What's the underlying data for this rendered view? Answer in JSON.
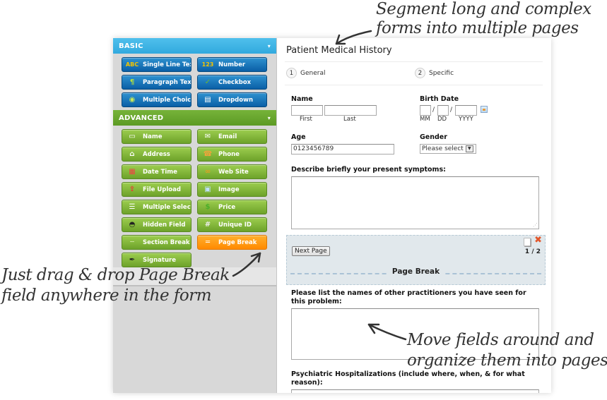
{
  "sidebar": {
    "basic": {
      "title": "BASIC",
      "caret": "▾",
      "items": [
        {
          "label": "Single Line Text",
          "icon": "abc-icon",
          "glyph": "ABC"
        },
        {
          "label": "Number",
          "icon": "number-123-icon",
          "glyph": "123"
        },
        {
          "label": "Paragraph Text",
          "icon": "paragraph-icon",
          "glyph": "¶"
        },
        {
          "label": "Checkbox",
          "icon": "checkbox-icon",
          "glyph": "✓"
        },
        {
          "label": "Multiple Choice",
          "icon": "radio-icon",
          "glyph": "◉"
        },
        {
          "label": "Dropdown",
          "icon": "dropdown-icon",
          "glyph": "▤"
        }
      ]
    },
    "advanced": {
      "title": "ADVANCED",
      "caret": "▾",
      "items": [
        {
          "label": "Name",
          "icon": "id-card-icon",
          "glyph": "▭"
        },
        {
          "label": "Email",
          "icon": "email-icon",
          "glyph": "✉"
        },
        {
          "label": "Address",
          "icon": "home-icon",
          "glyph": "⌂"
        },
        {
          "label": "Phone",
          "icon": "phone-icon",
          "glyph": "☎"
        },
        {
          "label": "Date Time",
          "icon": "calendar-icon",
          "glyph": "▦"
        },
        {
          "label": "Web Site",
          "icon": "link-icon",
          "glyph": "∞"
        },
        {
          "label": "File Upload",
          "icon": "file-upload-icon",
          "glyph": "⇪"
        },
        {
          "label": "Image",
          "icon": "image-icon",
          "glyph": "▣"
        },
        {
          "label": "Multiple Select",
          "icon": "multi-select-icon",
          "glyph": "☰"
        },
        {
          "label": "Price",
          "icon": "dollar-icon",
          "glyph": "$"
        },
        {
          "label": "Hidden Field",
          "icon": "mask-icon",
          "glyph": "◓"
        },
        {
          "label": "Unique ID",
          "icon": "unique-id-icon",
          "glyph": "#"
        },
        {
          "label": "Section Break",
          "icon": "section-break-icon",
          "glyph": "┄"
        },
        {
          "label": "Page Break",
          "icon": "page-break-icon",
          "glyph": "═",
          "highlighted": true
        },
        {
          "label": "Signature",
          "icon": "pen-icon",
          "glyph": "✒"
        }
      ]
    }
  },
  "form": {
    "title": "Patient Medical History",
    "steps": [
      {
        "num": "1",
        "label": "General"
      },
      {
        "num": "2",
        "label": "Specific"
      }
    ],
    "name": {
      "label": "Name",
      "first": "First",
      "last": "Last"
    },
    "birth_date": {
      "label": "Birth Date",
      "mm": "MM",
      "dd": "DD",
      "yyyy": "YYYY",
      "sep": "/"
    },
    "age": {
      "label": "Age",
      "value": "0123456789"
    },
    "gender": {
      "label": "Gender",
      "selected": "Please select"
    },
    "symptoms": {
      "label": "Describe briefly your present symptoms:"
    },
    "page_break": {
      "next_label": "Next Page",
      "page_count": "1 / 2",
      "label": "Page Break"
    },
    "practitioners": {
      "label": "Please list the names of other practitioners you have seen for this problem:"
    },
    "hospitalizations": {
      "label": "Psychiatric Hospitalizations (include where, when, & for what reason):"
    }
  },
  "annotations": {
    "top_line1": "Segment long and complex",
    "top_line2": "forms into multiple pages",
    "left_line1": "Just drag & drop Page Break",
    "left_line2": "field anywhere in the form",
    "right_line1": "Move fields around and",
    "right_line2": "organize them into pages"
  },
  "colors": {
    "basic_header": "#3cb3e4",
    "advanced_header": "#66a62c",
    "blue_button": "#0a6bb3",
    "green_button": "#7fb236",
    "page_break_button": "#ff9a10",
    "delete_icon": "#e2572b"
  }
}
